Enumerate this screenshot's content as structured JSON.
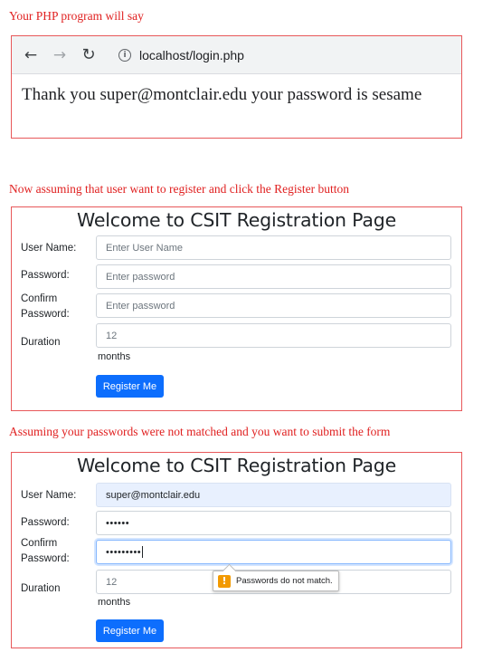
{
  "captions": {
    "php_result": "Your PHP program will say",
    "register_intro": "Now assuming that user want to register and click the Register button",
    "mismatch_intro": "Assuming your passwords were not matched and you want to submit the form"
  },
  "browser": {
    "url": "localhost/login.php",
    "message": "Thank you super@montclair.edu your password is sesame"
  },
  "form_empty": {
    "title": "Welcome to CSIT Registration Page",
    "username_label": "User Name:",
    "username_placeholder": "Enter User Name",
    "password_label": "Password:",
    "password_placeholder": "Enter password",
    "confirm_label_line1": "Confirm",
    "confirm_label_line2": "Password:",
    "confirm_placeholder": "Enter password",
    "duration_label": "Duration",
    "duration_value": "12",
    "duration_unit": "months",
    "submit_label": "Register Me"
  },
  "form_mismatch": {
    "title": "Welcome to CSIT Registration Page",
    "username_label": "User Name:",
    "username_value": "super@montclair.edu",
    "password_label": "Password:",
    "password_value": "••••••",
    "confirm_label_line1": "Confirm",
    "confirm_label_line2": "Password:",
    "confirm_value": "•••••••••",
    "duration_label": "Duration",
    "duration_value": "12",
    "duration_unit": "months",
    "submit_label": "Register Me",
    "validation_message": "Passwords do not match.",
    "validation_icon": "!"
  },
  "colors": {
    "caption": "#e02020",
    "box_border": "#e8585a",
    "button": "#0d6efd",
    "warning": "#f29900"
  }
}
